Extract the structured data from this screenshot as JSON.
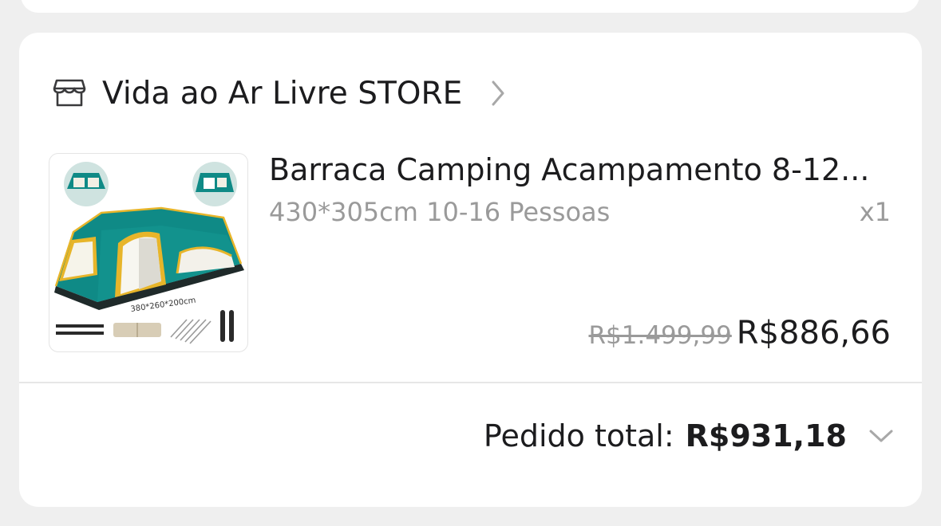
{
  "store": {
    "name": "Vida ao Ar Livre STORE",
    "icon": "store-icon",
    "chevron_icon": "chevron-right-icon"
  },
  "product": {
    "title": "Barraca Camping Acampamento 8-12...",
    "variant": "430*305cm 10-16 Pessoas",
    "quantity": "x1",
    "price_original": "R$1.499,99",
    "price_current": "R$886,66",
    "image": {
      "description_icon": "tent-product-image",
      "label": "380*260*200cm",
      "colors": {
        "tent": "#0f8a86",
        "frame": "#e7b52a"
      }
    }
  },
  "summary": {
    "total_label": "Pedido total:",
    "total_value": "R$931,18",
    "expand_icon": "chevron-down-icon"
  },
  "colors": {
    "background": "#efefef",
    "card": "#ffffff",
    "text_primary": "#1c1c1e",
    "text_secondary": "#9a9a9a"
  }
}
